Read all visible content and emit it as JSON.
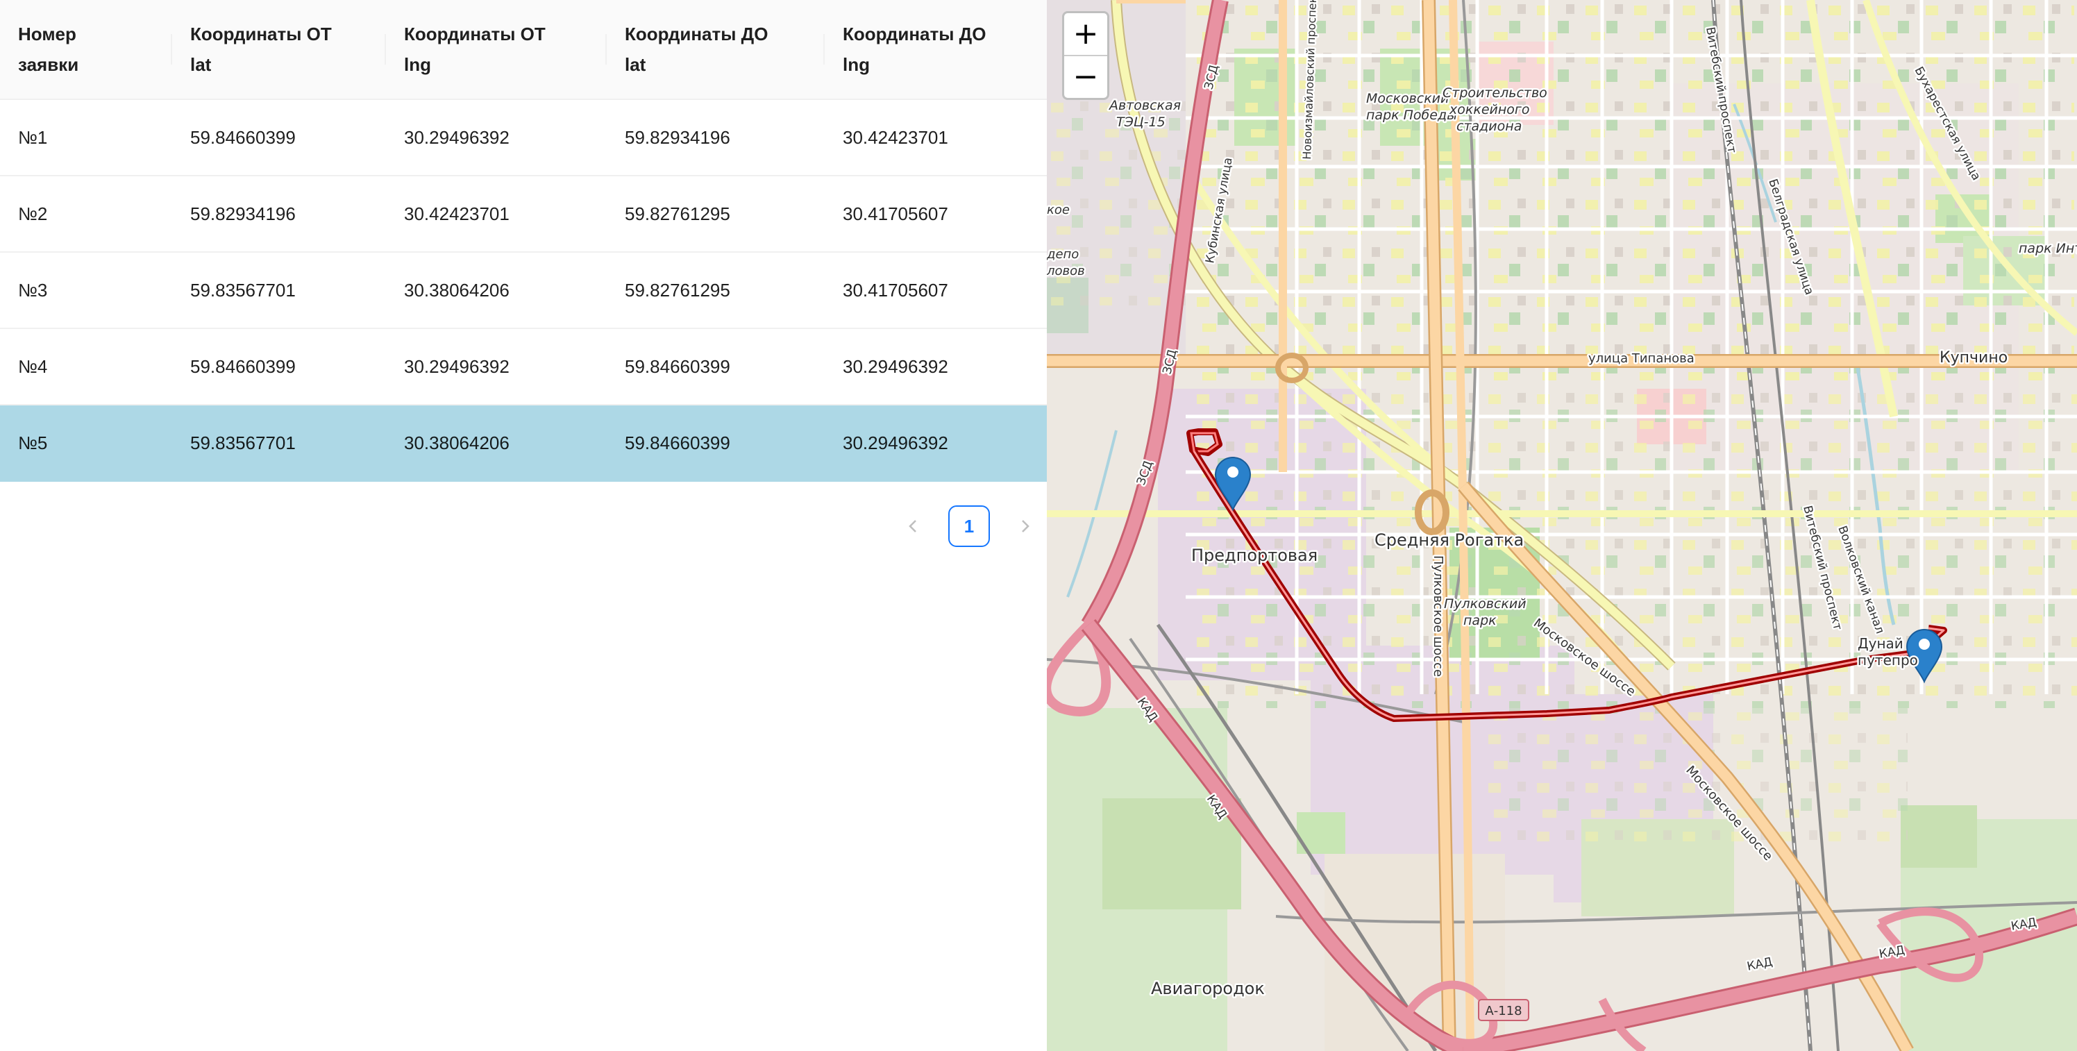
{
  "table": {
    "columns": [
      {
        "line1": "Номер",
        "line2": "заявки"
      },
      {
        "line1": "Координаты ОТ",
        "line2": "lat"
      },
      {
        "line1": "Координаты ОТ",
        "line2": "lng"
      },
      {
        "line1": "Координаты ДО",
        "line2": "lat"
      },
      {
        "line1": "Координаты ДО",
        "line2": "lng"
      }
    ],
    "rows": [
      {
        "id": "№1",
        "from_lat": "59.84660399",
        "from_lng": "30.29496392",
        "to_lat": "59.82934196",
        "to_lng": "30.42423701"
      },
      {
        "id": "№2",
        "from_lat": "59.82934196",
        "from_lng": "30.42423701",
        "to_lat": "59.82761295",
        "to_lng": "30.41705607"
      },
      {
        "id": "№3",
        "from_lat": "59.83567701",
        "from_lng": "30.38064206",
        "to_lat": "59.82761295",
        "to_lng": "30.41705607"
      },
      {
        "id": "№4",
        "from_lat": "59.84660399",
        "from_lng": "30.29496392",
        "to_lat": "59.84660399",
        "to_lng": "30.29496392"
      },
      {
        "id": "№5",
        "from_lat": "59.83567701",
        "from_lng": "30.38064206",
        "to_lat": "59.84660399",
        "to_lng": "30.29496392"
      }
    ],
    "selected_row": "№5",
    "selected_color": "#add8e6"
  },
  "pagination": {
    "prev_icon": "chevron-left-icon",
    "current_page": "1",
    "next_icon": "chevron-right-icon"
  },
  "map": {
    "zoom_in_label": "+",
    "zoom_out_label": "−",
    "route_color": "#cc0000",
    "marker_color": "#2a81cb",
    "labels": {
      "district_1": "Купчино",
      "district_2": "Средняя Рогатка",
      "district_3": "Предпортовая",
      "district_4": "Авиагородок",
      "park_1": "Московский",
      "park_1b": "парк Победы",
      "park_2": "Пулковский",
      "park_2b": "парк",
      "stadium_1": "Строительство",
      "stadium_2": "хоккейного",
      "stadium_3": "стадиона",
      "street_1": "улица Типанова",
      "street_2": "Московское шоссе",
      "street_3": "Пулковское шоссе",
      "street_4": "Витебский проспект",
      "street_5": "Кубинская улица",
      "street_6": "Новоизмайловский проспект",
      "street_7": "Белградская улица",
      "street_8": "Бухарестская улица",
      "road_1": "ЗСД",
      "road_2": "КАД",
      "road_3": "А-118",
      "tec": "Автовская",
      "tec_2": "ТЭЦ-15",
      "park_3": "парк Интер",
      "danube": "Дунай",
      "danube_2": "путепро",
      "canal": "Волковский канал",
      "depo": "кое",
      "depo_2": "депо",
      "depo_3": "ловов"
    }
  }
}
